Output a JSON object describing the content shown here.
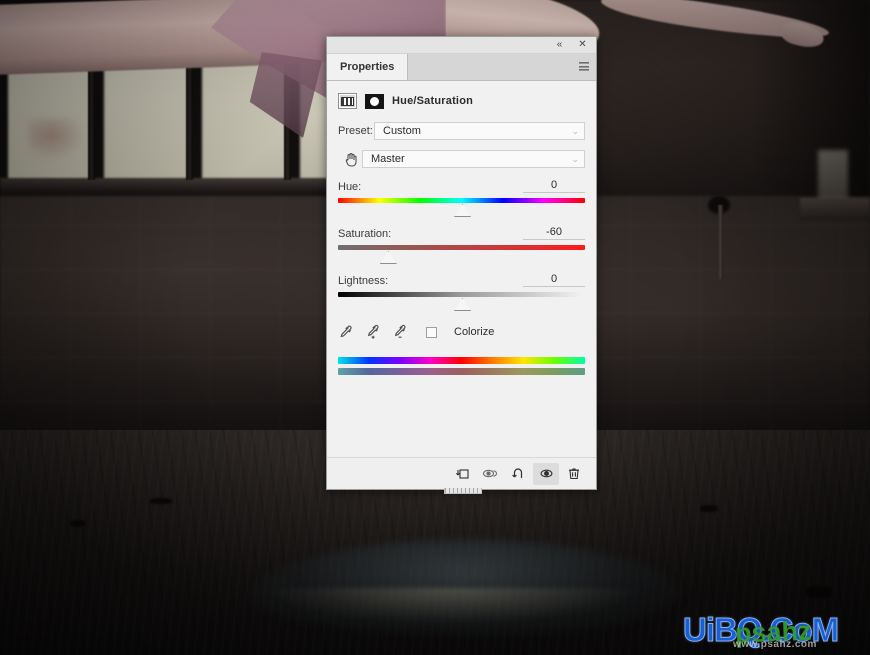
{
  "window": {
    "collapse_icon": "double-chevron-left-icon",
    "close_icon": "close-icon",
    "menu_icon": "panel-menu-icon"
  },
  "panel": {
    "tab_label": "Properties",
    "adjustment": {
      "preset_icon": "adjustment-preset-icon",
      "mask_icon": "layer-mask-icon",
      "title": "Hue/Saturation"
    },
    "preset_row": {
      "label": "Preset:",
      "value": "Custom",
      "chevron": "⌄"
    },
    "channel_row": {
      "cursor_icon": "hand-grab-cursor-icon",
      "value": "Master",
      "chevron": "⌄"
    },
    "sliders": [
      {
        "name": "Hue:",
        "value": "0",
        "percent": 50
      },
      {
        "name": "Saturation:",
        "value": "-60",
        "percent": 20
      },
      {
        "name": "Lightness:",
        "value": "0",
        "percent": 50
      }
    ],
    "tools": {
      "eyedropper": "eyedropper-icon",
      "eyedropper_add": "eyedropper-add-icon",
      "eyedropper_subtract": "eyedropper-subtract-icon",
      "colorize_label": "Colorize",
      "colorize_checked": false
    },
    "footer_buttons": [
      {
        "icon": "clip-to-layer-icon",
        "name": "clip-to-layer-button",
        "active": false
      },
      {
        "icon": "view-previous-state-icon",
        "name": "view-previous-state-button",
        "active": false
      },
      {
        "icon": "reset-icon",
        "name": "reset-button",
        "active": false
      },
      {
        "icon": "eye-visibility-icon",
        "name": "toggle-visibility-button",
        "active": true
      },
      {
        "icon": "trash-icon",
        "name": "delete-adjustment-button",
        "active": false
      }
    ]
  },
  "watermark": {
    "main": "UiBQ.CoM",
    "overlay": "psahz",
    "sub": "www.psahz.com"
  },
  "colors": {
    "panel_bg": "#f1f1f1",
    "tab_strip": "#d6d6d6",
    "accent_red": "#ff1a1a",
    "watermark_blue": "#1b5fd0",
    "watermark_green": "#2f9e2f"
  }
}
